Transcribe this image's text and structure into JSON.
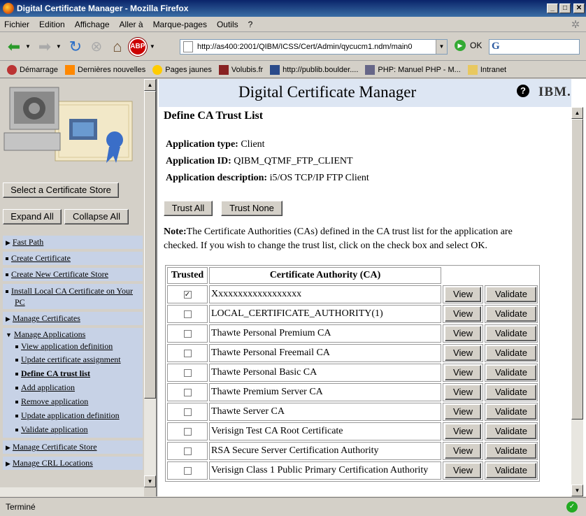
{
  "window": {
    "title": "Digital Certificate Manager - Mozilla Firefox"
  },
  "menu": [
    "Fichier",
    "Edition",
    "Affichage",
    "Aller à",
    "Marque-pages",
    "Outils",
    "?"
  ],
  "nav": {
    "url": "http://as400:2001/QIBM/ICSS/Cert/Admin/qycucm1.ndm/main0",
    "go_label": "OK",
    "abp_label": "ABP"
  },
  "bookmarks": [
    {
      "label": "Démarrage",
      "icon": "bug-icon"
    },
    {
      "label": "Dernières nouvelles",
      "icon": "rss-icon"
    },
    {
      "label": "Pages jaunes",
      "icon": "pagesjaunes-icon"
    },
    {
      "label": "Volubis.fr",
      "icon": "volubis-icon"
    },
    {
      "label": "http://publib.boulder....",
      "icon": "ibm-icon"
    },
    {
      "label": "PHP: Manuel PHP - M...",
      "icon": "php-icon"
    },
    {
      "label": "Intranet",
      "icon": "folder-icon"
    }
  ],
  "left": {
    "select_store": "Select a Certificate Store",
    "expand_all": "Expand All",
    "collapse_all": "Collapse All",
    "items": {
      "fast_path": "Fast Path",
      "create_cert": "Create Certificate",
      "create_store": "Create New Certificate Store",
      "install_ca": "Install Local CA Certificate on Your PC",
      "manage_certs": "Manage Certificates",
      "manage_apps": "Manage Applications",
      "sub": [
        "View application definition",
        "Update certificate assignment",
        "Define CA trust list",
        "Add application",
        "Remove application",
        "Update application definition",
        "Validate application"
      ],
      "manage_store": "Manage Certificate Store",
      "manage_crl": "Manage CRL Locations"
    }
  },
  "header": {
    "title": "Digital Certificate Manager",
    "help": "?",
    "brand": "IBM."
  },
  "main": {
    "heading": "Define CA Trust List",
    "app_type_label": "Application type:",
    "app_type": "Client",
    "app_id_label": "Application ID:",
    "app_id": "QIBM_QTMF_FTP_CLIENT",
    "app_desc_label": "Application description:",
    "app_desc": "i5/OS TCP/IP FTP Client",
    "trust_all": "Trust All",
    "trust_none": "Trust None",
    "note_label": "Note:",
    "note": "The Certificate Authorities (CAs) defined in the CA trust list for the application are checked. If you wish to change the trust list, click on the check box and select OK.",
    "col_trusted": "Trusted",
    "col_ca": "Certificate Authority (CA)",
    "view_label": "View",
    "validate_label": "Validate",
    "rows": [
      {
        "name": "Xxxxxxxxxxxxxxxxxx",
        "checked": true
      },
      {
        "name": "LOCAL_CERTIFICATE_AUTHORITY(1)",
        "checked": false
      },
      {
        "name": "Thawte Personal Premium CA",
        "checked": false
      },
      {
        "name": "Thawte Personal Freemail CA",
        "checked": false
      },
      {
        "name": "Thawte Personal Basic CA",
        "checked": false
      },
      {
        "name": "Thawte Premium Server CA",
        "checked": false
      },
      {
        "name": "Thawte Server CA",
        "checked": false
      },
      {
        "name": "Verisign Test CA Root Certificate",
        "checked": false
      },
      {
        "name": "RSA Secure Server Certification Authority",
        "checked": false
      },
      {
        "name": "Verisign Class 1 Public Primary Certification Authority",
        "checked": false
      }
    ]
  },
  "status": {
    "text": "Terminé"
  }
}
